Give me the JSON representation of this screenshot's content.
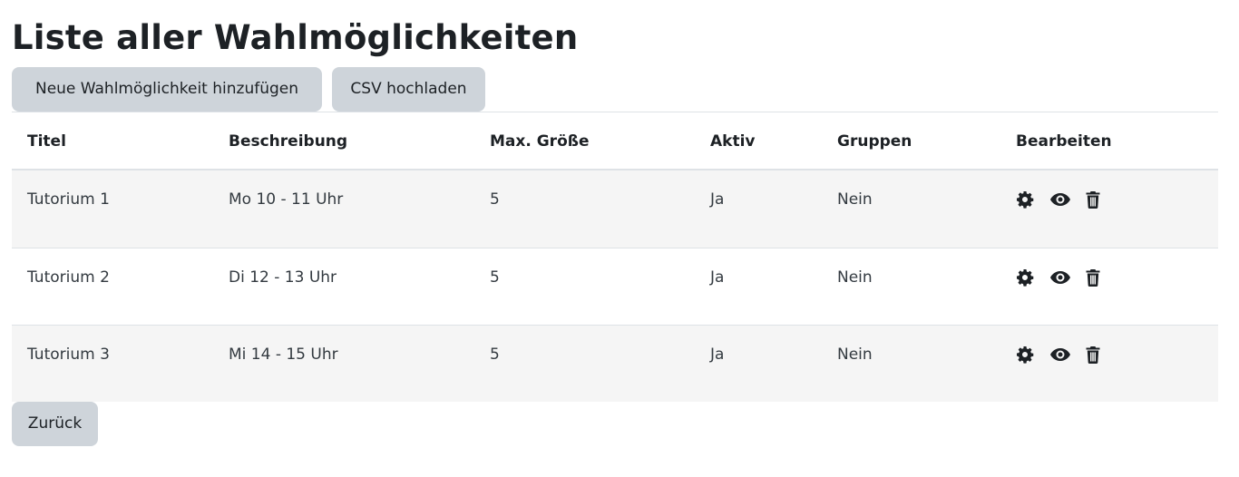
{
  "page": {
    "title": "Liste aller Wahlmöglichkeiten"
  },
  "toolbar": {
    "add_label": "Neue Wahlmöglichkeit hinzufügen",
    "csv_label": "CSV hochladen"
  },
  "table": {
    "headers": [
      "Titel",
      "Beschreibung",
      "Max. Größe",
      "Aktiv",
      "Gruppen",
      "Bearbeiten"
    ],
    "rows": [
      {
        "title": "Tutorium 1",
        "description": "Mo 10 - 11 Uhr",
        "max_size": "5",
        "active": "Ja",
        "groups": "Nein"
      },
      {
        "title": "Tutorium 2",
        "description": "Di 12 - 13 Uhr",
        "max_size": "5",
        "active": "Ja",
        "groups": "Nein"
      },
      {
        "title": "Tutorium 3",
        "description": "Mi 14 - 15 Uhr",
        "max_size": "5",
        "active": "Ja",
        "groups": "Nein"
      }
    ],
    "action_icons": [
      "gear-icon",
      "eye-icon",
      "trash-icon"
    ]
  },
  "footer": {
    "back_label": "Zurück"
  },
  "colors": {
    "button_bg": "#ced4da",
    "text": "#1d2125",
    "stripe": "#f5f5f5",
    "border": "#dee2e6"
  }
}
